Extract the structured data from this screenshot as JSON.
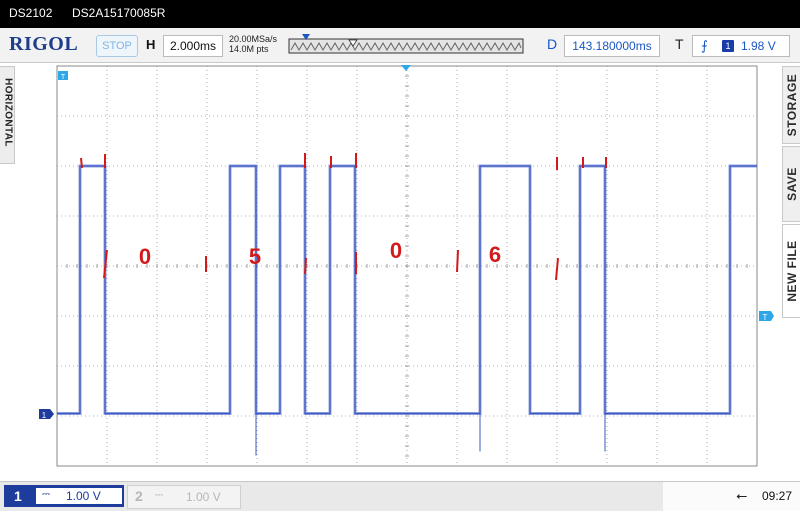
{
  "title": {
    "model": "DS2102",
    "serial": "DS2A15170085R"
  },
  "brand": "RIGOL",
  "status": "STOP",
  "horizontal": {
    "label": "H",
    "timebase": "2.000ms",
    "sample_rate": "20.00MSa/s",
    "memory_depth": "14.0M pts"
  },
  "delay": {
    "label": "D",
    "value": "143.180000ms"
  },
  "trigger": {
    "label": "T",
    "edge_icon": "rising-edge-icon",
    "source": "1",
    "level": "1.98 V"
  },
  "left_tab": "HORIZONTAL",
  "right_tabs": [
    "STORAGE",
    "SAVE",
    "NEW FILE"
  ],
  "markers": {
    "ch1": "1",
    "trigger_marker": "T"
  },
  "annotations": [
    "0",
    "5",
    "0",
    "6"
  ],
  "channels": [
    {
      "num": "1",
      "coupling_icon": "dc-coupling-icon",
      "coupling_text": "⎓",
      "scale": "1.00 V",
      "active": true
    },
    {
      "num": "2",
      "coupling_icon": "dc-coupling-icon",
      "coupling_text": "⎓",
      "scale": "1.00 V",
      "active": false
    }
  ],
  "clock": "09:27",
  "colors": {
    "trace": "#3b58c4",
    "annotation": "#d21a1a",
    "grid": "#9b9b9b",
    "brand": "#1f3e8a",
    "ch1": "#1d3c9c"
  },
  "waveform": {
    "time_divs": 14,
    "volt_divs": 8,
    "low_level_div": 6.95,
    "high_level_div": 2.0,
    "edges_div": [
      0.46,
      0.96,
      3.46,
      3.98,
      4.46,
      4.96,
      5.46,
      5.96,
      8.46,
      9.46,
      10.46,
      10.96,
      13.46
    ],
    "start_high": false
  }
}
